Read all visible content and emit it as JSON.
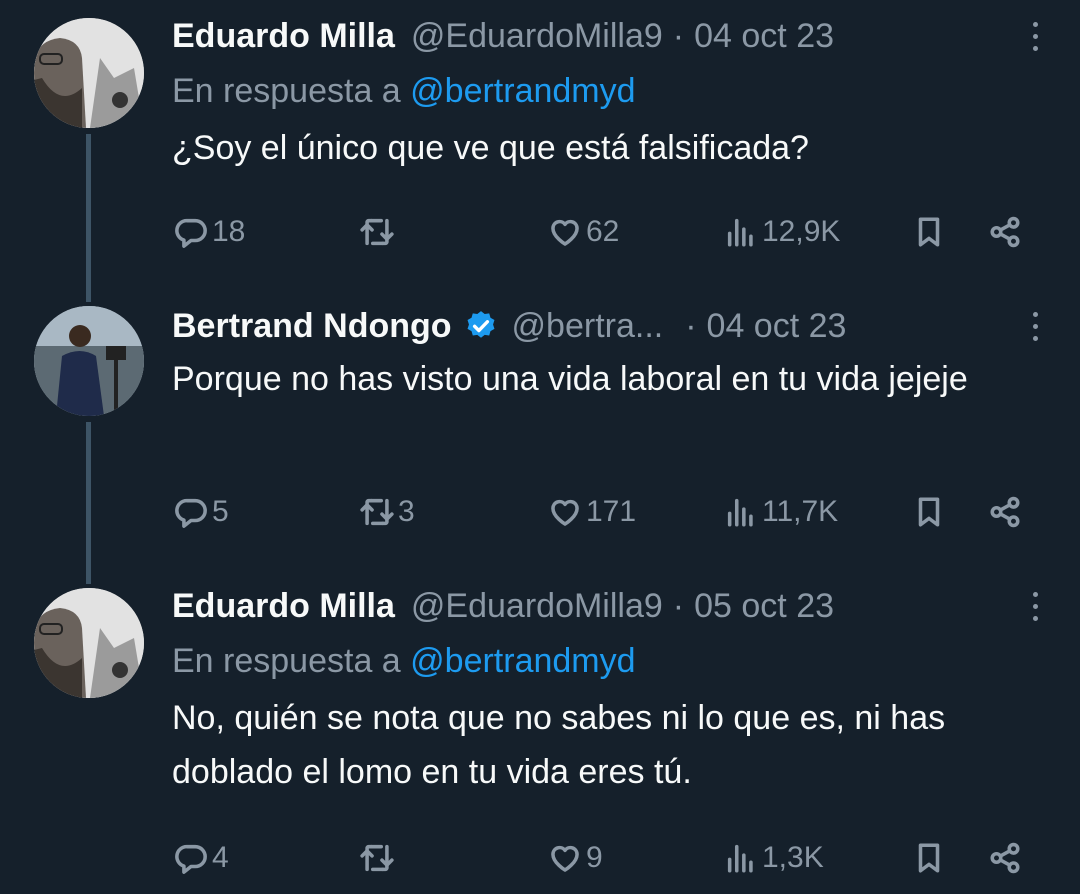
{
  "tweets": [
    {
      "name": "Eduardo Milla",
      "handle": "@EduardoMilla9",
      "date": "04 oct 23",
      "reply_prefix": "En respuesta a",
      "reply_mention": "@bertrandmyd",
      "text": "¿Soy el único que ve que está falsificada?",
      "replies": "18",
      "retweets": "",
      "likes": "62",
      "views": "12,9K"
    },
    {
      "name": "Bertrand Ndongo",
      "handle": "@bertra...",
      "date": "04 oct 23",
      "verified": true,
      "text": "Porque no has visto una vida laboral en tu vida jejeje",
      "replies": "5",
      "retweets": "3",
      "likes": "171",
      "views": "11,7K"
    },
    {
      "name": "Eduardo Milla",
      "handle": "@EduardoMilla9",
      "date": "05 oct 23",
      "reply_prefix": "En respuesta a",
      "reply_mention": "@bertrandmyd",
      "text": "No, quién se nota que no sabes ni lo que es, ni has doblado el lomo en tu vida eres tú.",
      "replies": "4",
      "retweets": "",
      "likes": "9",
      "views": "1,3K"
    }
  ],
  "colors": {
    "background": "#15202b",
    "text_primary": "#f7f9f9",
    "text_secondary": "#8b98a5",
    "link": "#1d9bf0",
    "thread_line": "#3d5466"
  },
  "icons": [
    "reply-icon",
    "retweet-icon",
    "like-icon",
    "views-icon",
    "bookmark-icon",
    "share-icon",
    "more-icon",
    "verified-icon"
  ]
}
